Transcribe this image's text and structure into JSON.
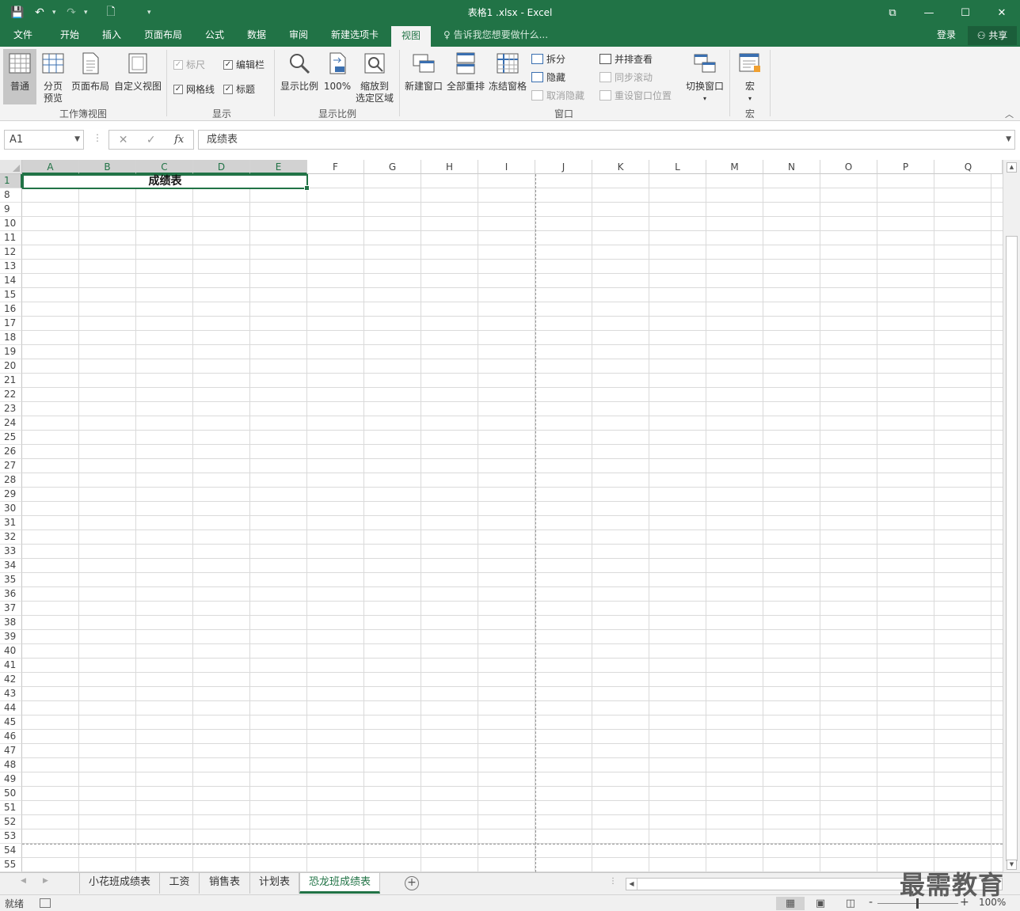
{
  "window": {
    "title": "表格1 .xlsx - Excel",
    "controls": [
      "⧉",
      "—",
      "☐",
      "✕"
    ]
  },
  "qat": {
    "save": "💾",
    "undo": "↶",
    "redo": "↷",
    "new": "🗋",
    "more": "▾"
  },
  "tabs": [
    "文件",
    "开始",
    "插入",
    "页面布局",
    "公式",
    "数据",
    "审阅",
    "新建选项卡",
    "视图"
  ],
  "active_tab": "视图",
  "tell_me": "告诉我您想要做什么...",
  "login": "登录",
  "share": "共享",
  "ribbon": {
    "workbook_views": {
      "label": "工作簿视图",
      "normal": "普通",
      "page_break": [
        "分页",
        "预览"
      ],
      "page_layout": "页面布局",
      "custom": "自定义视图"
    },
    "show": {
      "label": "显示",
      "ruler": "标尺",
      "formula_bar": "编辑栏",
      "gridlines": "网格线",
      "headings": "标题"
    },
    "zoom": {
      "label": "显示比例",
      "zoom": "显示比例",
      "hundred": "100%",
      "to_selection": [
        "缩放到",
        "选定区域"
      ]
    },
    "window": {
      "label": "窗口",
      "new_window": "新建窗口",
      "arrange_all": "全部重排",
      "freeze": "冻结窗格",
      "split": "拆分",
      "hide": "隐藏",
      "unhide": "取消隐藏",
      "side_by_side": "并排查看",
      "sync_scroll": "同步滚动",
      "reset_pos": "重设窗口位置",
      "switch": "切换窗口"
    },
    "macros": {
      "label": "宏",
      "macros": "宏"
    }
  },
  "formula_bar": {
    "name_box": "A1",
    "content": "成绩表",
    "fx": "fx"
  },
  "columns": [
    "A",
    "B",
    "C",
    "D",
    "E",
    "F",
    "G",
    "H",
    "I",
    "J",
    "K",
    "L",
    "M",
    "N",
    "O",
    "P",
    "Q"
  ],
  "rows": [
    "1",
    "8",
    "9",
    "10",
    "11",
    "12",
    "13",
    "14",
    "15",
    "16",
    "17",
    "18",
    "19",
    "20",
    "21",
    "22",
    "23",
    "24",
    "25",
    "26",
    "27",
    "28",
    "29",
    "30",
    "31",
    "32",
    "33",
    "34",
    "35",
    "36",
    "37",
    "38",
    "39",
    "40",
    "41",
    "42",
    "43",
    "44",
    "45",
    "46",
    "47",
    "48",
    "49",
    "50",
    "51",
    "52",
    "53",
    "54",
    "55"
  ],
  "merged_cell_text": "成绩表",
  "sheets": [
    "小花班成绩表",
    "工资",
    "销售表",
    "计划表",
    "恐龙班成绩表"
  ],
  "active_sheet": "恐龙班成绩表",
  "status": {
    "ready": "就绪",
    "zoom": "100%"
  },
  "watermark": "最需教育"
}
